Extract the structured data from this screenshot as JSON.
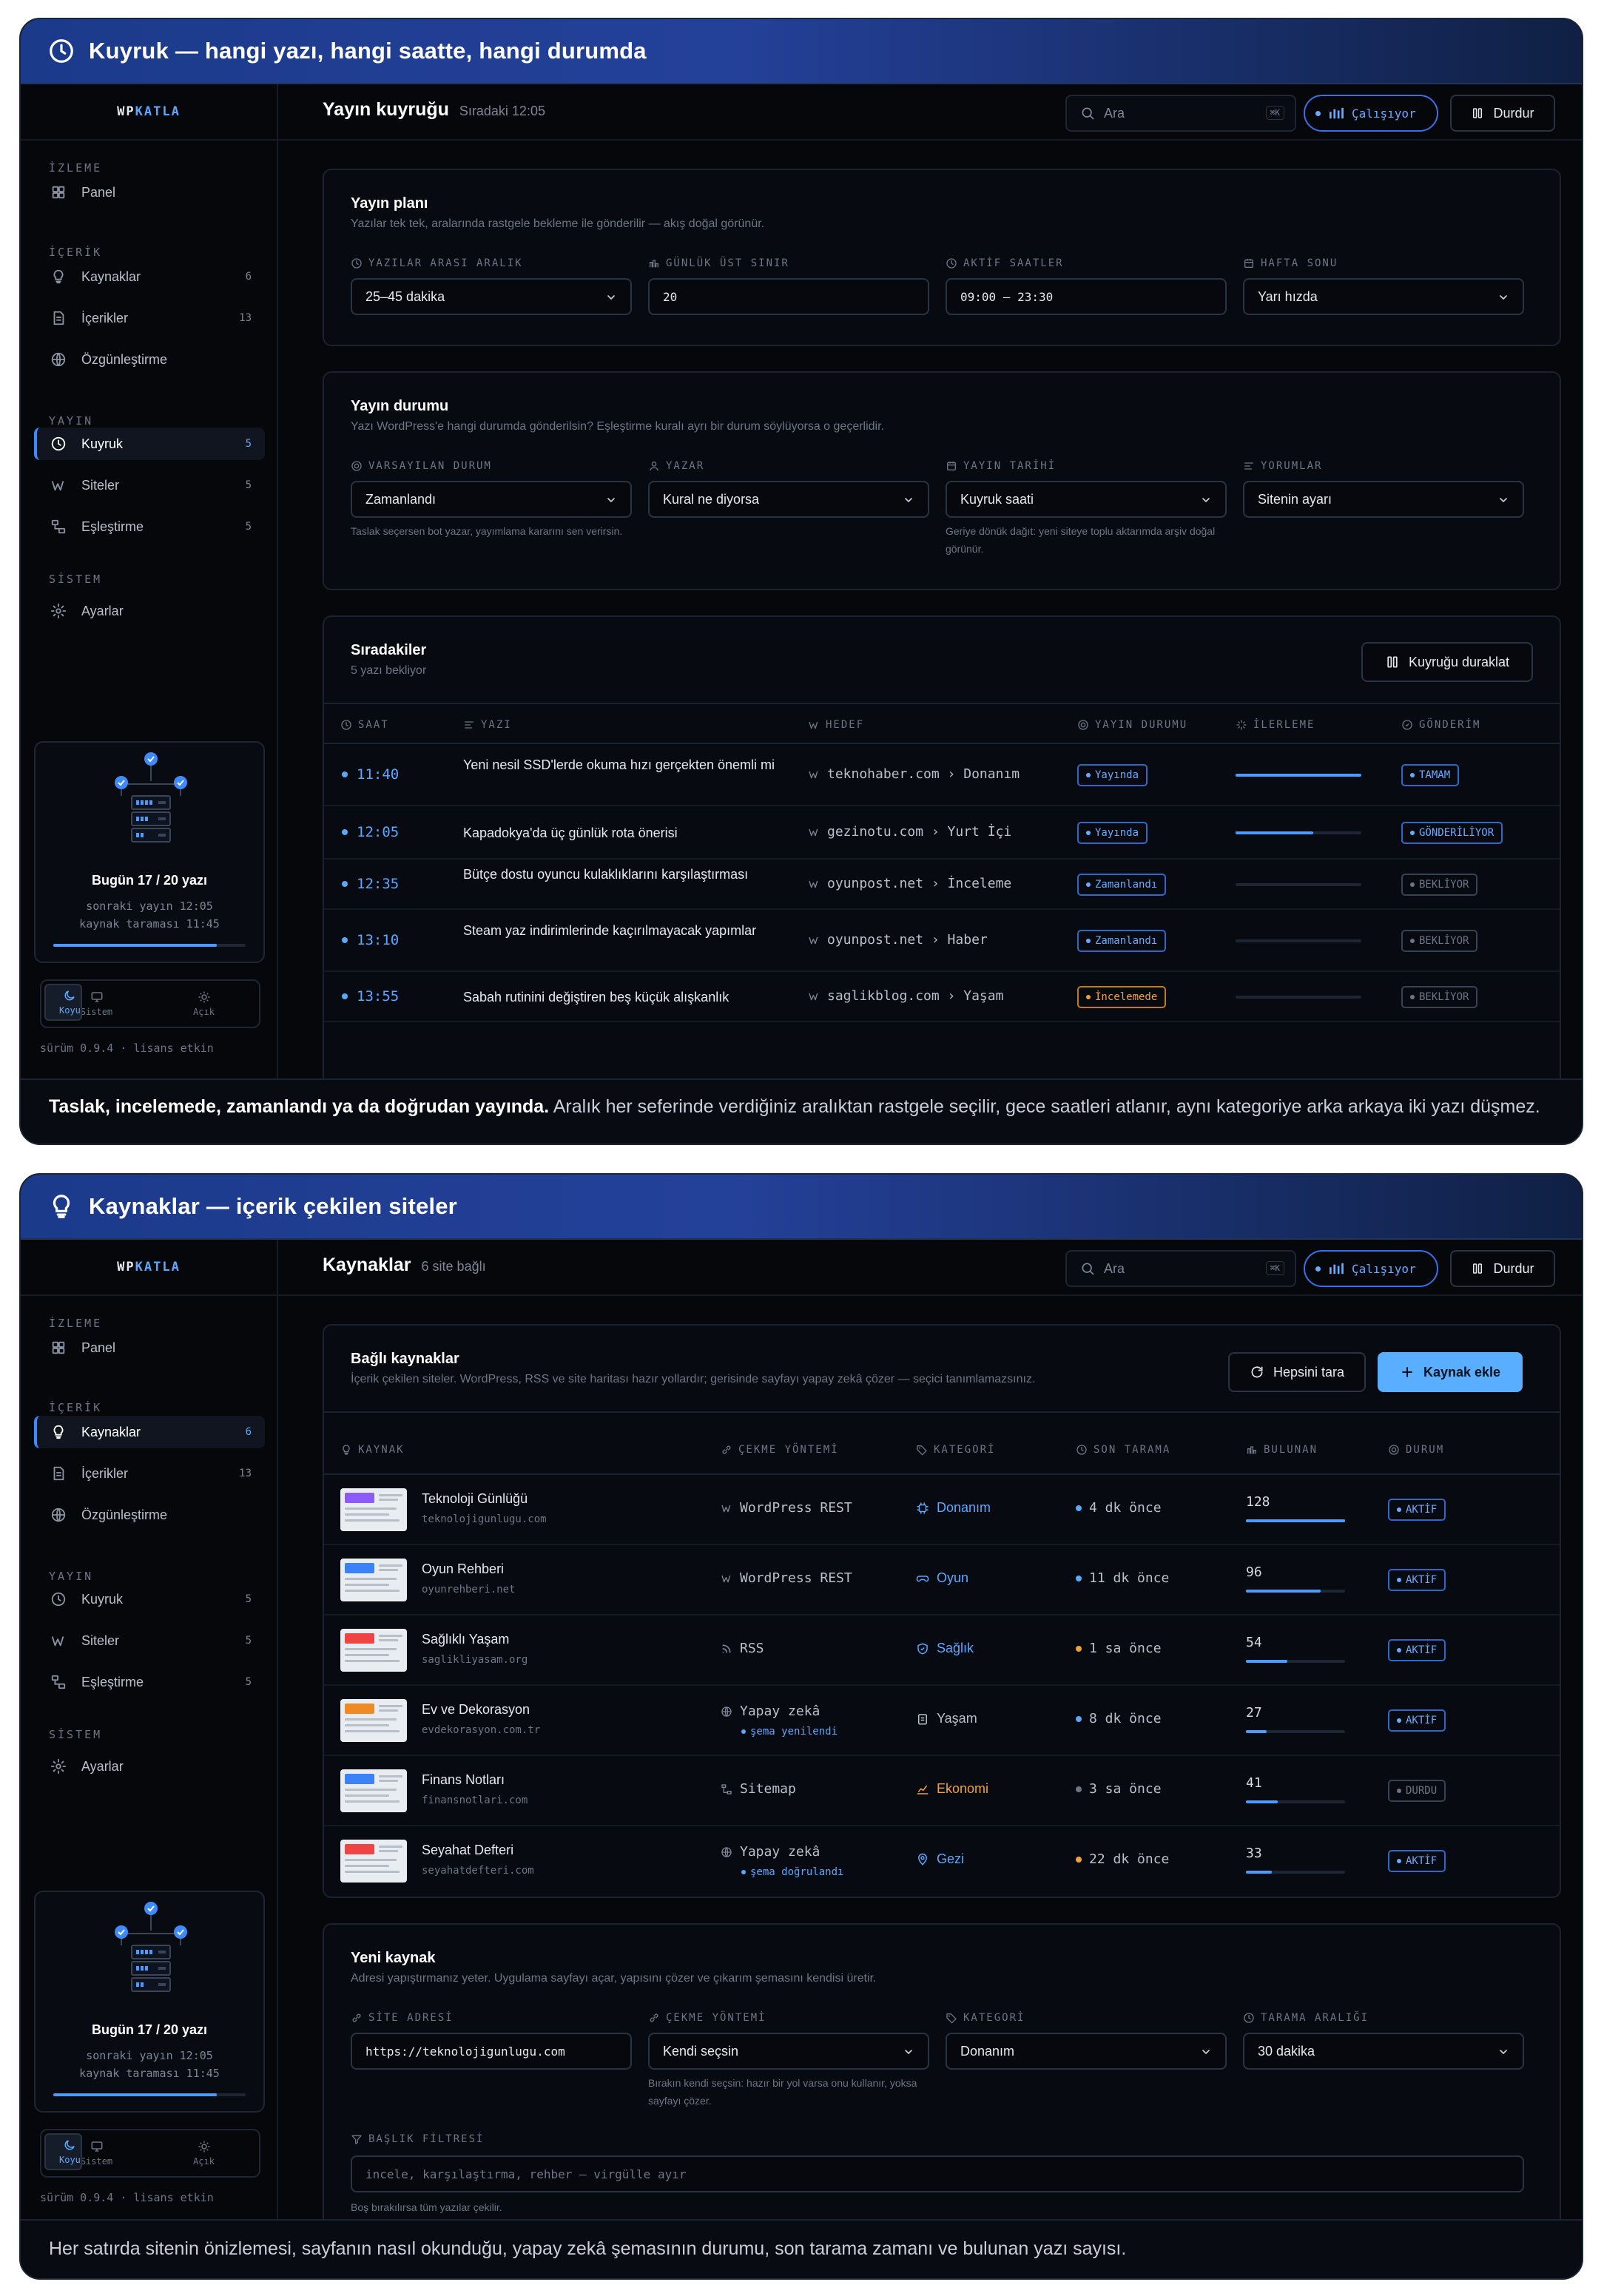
{
  "brand": {
    "prefix": "WP",
    "accent": "KATLA"
  },
  "sidebar": {
    "groups": [
      "İZLEME",
      "İÇERİK",
      "YAYIN",
      "SİSTEM"
    ],
    "items": [
      {
        "label": "Panel",
        "count": ""
      },
      {
        "label": "Kaynaklar",
        "count": "6"
      },
      {
        "label": "İçerikler",
        "count": "13"
      },
      {
        "label": "Özgünleştirme",
        "count": ""
      },
      {
        "label": "Kuyruk",
        "count": "5"
      },
      {
        "label": "Siteler",
        "count": "5"
      },
      {
        "label": "Eşleştirme",
        "count": "5"
      },
      {
        "label": "Ayarlar",
        "count": ""
      }
    ],
    "status": {
      "today": "Bugün 17 / 20 yazı",
      "next": "sonraki yayın 12:05",
      "scan": "kaynak taraması 11:45",
      "progress": 0.85
    },
    "theme": [
      "Sistem",
      "Açık",
      "Koyu"
    ],
    "version": "sürüm 0.9.4 · lisans etkin"
  },
  "header": {
    "search_placeholder": "Ara",
    "kbd": "⌘K",
    "running": "Çalışıyor",
    "stop": "Durdur"
  },
  "colors": {
    "accent": "#5aa8ff",
    "warning": "#f0a23a",
    "background": "#05070b"
  },
  "panel1": {
    "banner": "Kuyruk — hangi yazı, hangi saatte, hangi durumda",
    "title": "Yayın kuyruğu",
    "subtitle": "Sıradaki 12:05",
    "plan": {
      "title": "Yayın planı",
      "subtitle": "Yazılar tek tek, aralarında rastgele bekleme ile gönderilir — akış doğal görünür.",
      "fields": [
        {
          "label": "YAZILAR ARASI ARALIK",
          "value": "25–45 dakika"
        },
        {
          "label": "GÜNLÜK ÜST SINIR",
          "value": "20"
        },
        {
          "label": "AKTİF SAATLER",
          "value": "09:00 – 23:30"
        },
        {
          "label": "HAFTA SONU",
          "value": "Yarı hızda"
        }
      ]
    },
    "status": {
      "title": "Yayın durumu",
      "subtitle": "Yazı WordPress'e hangi durumda gönderilsin? Eşleştirme kuralı ayrı bir durum söylüyorsa o geçerlidir.",
      "fields": [
        {
          "label": "VARSAYILAN DURUM",
          "value": "Zamanlandı",
          "hint": "Taslak seçersen bot yazar, yayımlama kararını sen verirsin."
        },
        {
          "label": "YAZAR",
          "value": "Kural ne diyorsa",
          "hint": ""
        },
        {
          "label": "YAYIN TARİHİ",
          "value": "Kuyruk saati",
          "hint": "Geriye dönük dağıt: yeni siteye toplu aktarımda arşiv doğal görünür."
        },
        {
          "label": "YORUMLAR",
          "value": "Sitenin ayarı",
          "hint": ""
        }
      ]
    },
    "queue": {
      "title": "Sıradakiler",
      "subtitle": "5 yazı bekliyor",
      "pause": "Kuyruğu duraklat",
      "columns": [
        "SAAT",
        "YAZI",
        "HEDEF",
        "YAYIN DURUMU",
        "İLERLEME",
        "GÖNDERİM"
      ],
      "rows": [
        {
          "time": "11:40",
          "post": "Yeni nesil SSD'lerde okuma hızı gerçekten önemli mi",
          "target": "teknohaber.com › Donanım",
          "status": "Yayında",
          "status_kind": "blue",
          "progress": 1.0,
          "send": "TAMAM",
          "send_kind": "blue"
        },
        {
          "time": "12:05",
          "post": "Kapadokya'da üç günlük rota önerisi",
          "target": "gezinotu.com › Yurt İçi",
          "status": "Yayında",
          "status_kind": "blue",
          "progress": 0.62,
          "send": "GÖNDERİLİYOR",
          "send_kind": "blue"
        },
        {
          "time": "12:35",
          "post": "Bütçe dostu oyuncu kulaklıklarını karşılaştırması",
          "target": "oyunpost.net › İnceleme",
          "status": "Zamanlandı",
          "status_kind": "blue",
          "progress": 0,
          "send": "BEKLİYOR",
          "send_kind": "mute"
        },
        {
          "time": "13:10",
          "post": "Steam yaz indirimlerinde kaçırılmayacak yapımlar",
          "target": "oyunpost.net › Haber",
          "status": "Zamanlandı",
          "status_kind": "blue",
          "progress": 0,
          "send": "BEKLİYOR",
          "send_kind": "mute"
        },
        {
          "time": "13:55",
          "post": "Sabah rutinini değiştiren beş küçük alışkanlık",
          "target": "saglikblog.com › Yaşam",
          "status": "İncelemede",
          "status_kind": "warn",
          "progress": 0,
          "send": "BEKLİYOR",
          "send_kind": "mute"
        }
      ]
    },
    "caption_bold": "Taslak, incelemede, zamanlandı ya da doğrudan yayında.",
    "caption": " Aralık her seferinde verdiğiniz aralıktan rastgele seçilir, gece saatleri atlanır, aynı kategoriye arka arkaya iki yazı düşmez."
  },
  "panel2": {
    "banner": "Kaynaklar — içerik çekilen siteler",
    "title": "Kaynaklar",
    "subtitle": "6 site bağlı",
    "sources": {
      "title": "Bağlı kaynaklar",
      "subtitle": "İçerik çekilen siteler. WordPress, RSS ve site haritası hazır yollardır; gerisinde sayfayı yapay zekâ çözer — seçici tanımlamazsınız.",
      "scan_all": "Hepsini tara",
      "add": "Kaynak ekle",
      "columns": [
        "KAYNAK",
        "ÇEKME YÖNTEMİ",
        "KATEGORİ",
        "SON TARAMA",
        "BULUNAN",
        "DURUM"
      ],
      "rows": [
        {
          "name": "Teknoloji Günlüğü",
          "url": "teknolojigunlugu.com",
          "thumb": "#8b5cf6",
          "method": "WordPress REST",
          "method_sub": "",
          "category": "Donanım",
          "cat_color": "#5aa8ff",
          "scan": "4 dk önce",
          "scan_color": "#5aa8ff",
          "found": "128",
          "found_frac": 1.0,
          "status": "AKTİF",
          "status_kind": "blue"
        },
        {
          "name": "Oyun Rehberi",
          "url": "oyunrehberi.net",
          "thumb": "#3b82f6",
          "method": "WordPress REST",
          "method_sub": "",
          "category": "Oyun",
          "cat_color": "#5aa8ff",
          "scan": "11 dk önce",
          "scan_color": "#5aa8ff",
          "found": "96",
          "found_frac": 0.75,
          "status": "AKTİF",
          "status_kind": "blue"
        },
        {
          "name": "Sağlıklı Yaşam",
          "url": "saglikliyasam.org",
          "thumb": "#ef4444",
          "method": "RSS",
          "method_sub": "",
          "category": "Sağlık",
          "cat_color": "#5aa8ff",
          "scan": "1 sa önce",
          "scan_color": "#f0a23a",
          "found": "54",
          "found_frac": 0.42,
          "status": "AKTİF",
          "status_kind": "blue"
        },
        {
          "name": "Ev ve Dekorasyon",
          "url": "evdekorasyon.com.tr",
          "thumb": "#f08a24",
          "method": "Yapay zekâ",
          "method_sub": "şema yenilendi",
          "category": "Yaşam",
          "cat_color": "#b9c0cc",
          "scan": "8 dk önce",
          "scan_color": "#5aa8ff",
          "found": "27",
          "found_frac": 0.21,
          "status": "AKTİF",
          "status_kind": "blue"
        },
        {
          "name": "Finans Notları",
          "url": "finansnotlari.com",
          "thumb": "#3b82f6",
          "method": "Sitemap",
          "method_sub": "",
          "category": "Ekonomi",
          "cat_color": "#f0a23a",
          "scan": "3 sa önce",
          "scan_color": "#6d7686",
          "found": "41",
          "found_frac": 0.32,
          "status": "DURDU",
          "status_kind": "mute"
        },
        {
          "name": "Seyahat Defteri",
          "url": "seyahatdefteri.com",
          "thumb": "#ef4444",
          "method": "Yapay zekâ",
          "method_sub": "şema doğrulandı",
          "category": "Gezi",
          "cat_color": "#5aa8ff",
          "scan": "22 dk önce",
          "scan_color": "#f0a23a",
          "found": "33",
          "found_frac": 0.26,
          "status": "AKTİF",
          "status_kind": "blue"
        }
      ]
    },
    "new_source": {
      "title": "Yeni kaynak",
      "subtitle": "Adresi yapıştırmanız yeter. Uygulama sayfayı açar, yapısını çözer ve çıkarım şemasını kendisi üretir.",
      "fields": [
        {
          "label": "SİTE ADRESİ",
          "value": "https://teknolojigunlugu.com"
        },
        {
          "label": "ÇEKME YÖNTEMİ",
          "value": "Kendi seçsin",
          "hint": "Bırakın kendi seçsin: hazır bir yol varsa onu kullanır, yoksa sayfayı çözer."
        },
        {
          "label": "KATEGORİ",
          "value": "Donanım"
        },
        {
          "label": "TARAMA ARALIĞI",
          "value": "30 dakika"
        }
      ],
      "filter_label": "BAŞLIK FİLTRESİ",
      "filter_placeholder": "incele, karşılaştırma, rehber — virgülle ayır",
      "filter_hint": "Boş bırakılırsa tüm yazılar çekilir."
    },
    "caption": "Her satırda sitenin önizlemesi, sayfanın nasıl okunduğu, yapay zekâ şemasının durumu, son tarama zamanı ve bulunan yazı sayısı."
  }
}
